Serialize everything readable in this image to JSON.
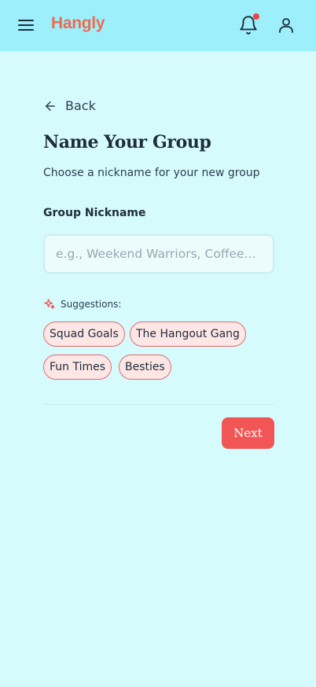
{
  "header": {
    "logo_text": "Hangly",
    "menu_icon": "hamburger-menu-icon",
    "notification_icon": "bell-icon",
    "profile_icon": "user-icon",
    "brand_color": "#ef6a4f",
    "background_color": "#9df0fb"
  },
  "main": {
    "back_label": "Back",
    "title": "Name Your Group",
    "subtitle": "Choose a nickname for your new group",
    "field_label": "Group Nickname",
    "input_value": "",
    "input_placeholder": "e.g., Weekend Warriors, Coffee...",
    "suggestions_label": "Suggestions:",
    "suggestions": [
      "Squad Goals",
      "The Hangout Gang",
      "Fun Times",
      "Besties"
    ],
    "next_label": "Next",
    "accent_color": "#f25555"
  }
}
